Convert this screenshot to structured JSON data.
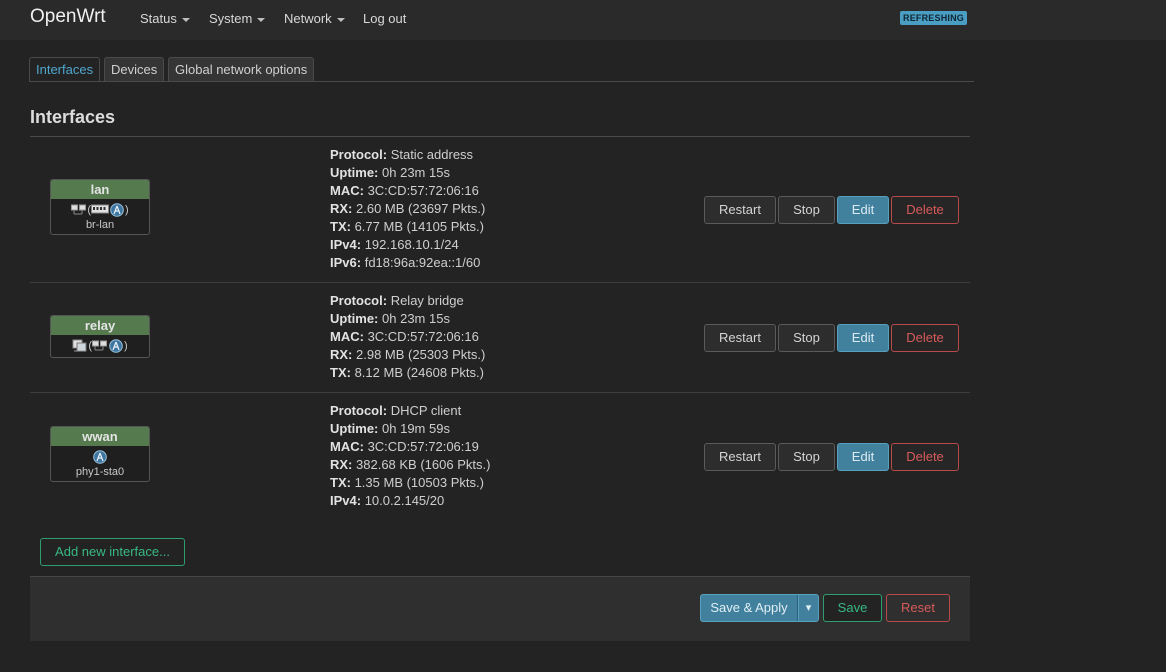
{
  "header": {
    "brand": "OpenWrt",
    "menu": [
      {
        "label": "Status",
        "has_dropdown": true
      },
      {
        "label": "System",
        "has_dropdown": true
      },
      {
        "label": "Network",
        "has_dropdown": true
      },
      {
        "label": "Log out",
        "has_dropdown": false
      }
    ],
    "badge": "REFRESHING"
  },
  "tabs": [
    {
      "label": "Interfaces",
      "active": true
    },
    {
      "label": "Devices",
      "active": false
    },
    {
      "label": "Global network options",
      "active": false
    }
  ],
  "page_title": "Interfaces",
  "interfaces": [
    {
      "name": "lan",
      "icon_paren_open": "(",
      "icon_paren_close": ")",
      "device": "br-lan",
      "icons": [
        "bridge-icon",
        "switch-icon",
        "wifi-icon"
      ],
      "details": [
        {
          "k": "Protocol:",
          "v": "Static address"
        },
        {
          "k": "Uptime:",
          "v": "0h 23m 15s"
        },
        {
          "k": "MAC:",
          "v": "3C:CD:57:72:06:16"
        },
        {
          "k": "RX:",
          "v": "2.60 MB (23697 Pkts.)"
        },
        {
          "k": "TX:",
          "v": "6.77 MB (14105 Pkts.)"
        },
        {
          "k": "IPv4:",
          "v": "192.168.10.1/24"
        },
        {
          "k": "IPv6:",
          "v": "fd18:96a:92ea::1/60"
        }
      ]
    },
    {
      "name": "relay",
      "icon_paren_open": "(",
      "icon_paren_close": ")",
      "device": "",
      "icons": [
        "relay-icon",
        "bridge-icon",
        "wifi-icon"
      ],
      "details": [
        {
          "k": "Protocol:",
          "v": "Relay bridge"
        },
        {
          "k": "Uptime:",
          "v": "0h 23m 15s"
        },
        {
          "k": "MAC:",
          "v": "3C:CD:57:72:06:16"
        },
        {
          "k": "RX:",
          "v": "2.98 MB (25303 Pkts.)"
        },
        {
          "k": "TX:",
          "v": "8.12 MB (24608 Pkts.)"
        }
      ]
    },
    {
      "name": "wwan",
      "device": "phy1-sta0",
      "icons": [
        "wifi-icon"
      ],
      "details": [
        {
          "k": "Protocol:",
          "v": "DHCP client"
        },
        {
          "k": "Uptime:",
          "v": "0h 19m 59s"
        },
        {
          "k": "MAC:",
          "v": "3C:CD:57:72:06:19"
        },
        {
          "k": "RX:",
          "v": "382.68 KB (1606 Pkts.)"
        },
        {
          "k": "TX:",
          "v": "1.35 MB (10503 Pkts.)"
        },
        {
          "k": "IPv4:",
          "v": "10.0.2.145/20"
        }
      ]
    }
  ],
  "row_actions": {
    "restart": "Restart",
    "stop": "Stop",
    "edit": "Edit",
    "delete": "Delete"
  },
  "add_button": "Add new interface...",
  "footer": {
    "save_apply": "Save & Apply",
    "dropdown": "▾",
    "save": "Save",
    "reset": "Reset"
  },
  "colors": {
    "background": "#232323",
    "accent": "#41819e",
    "interface_header": "#547a4e",
    "danger": "#d75a5a",
    "success": "#38b884"
  }
}
